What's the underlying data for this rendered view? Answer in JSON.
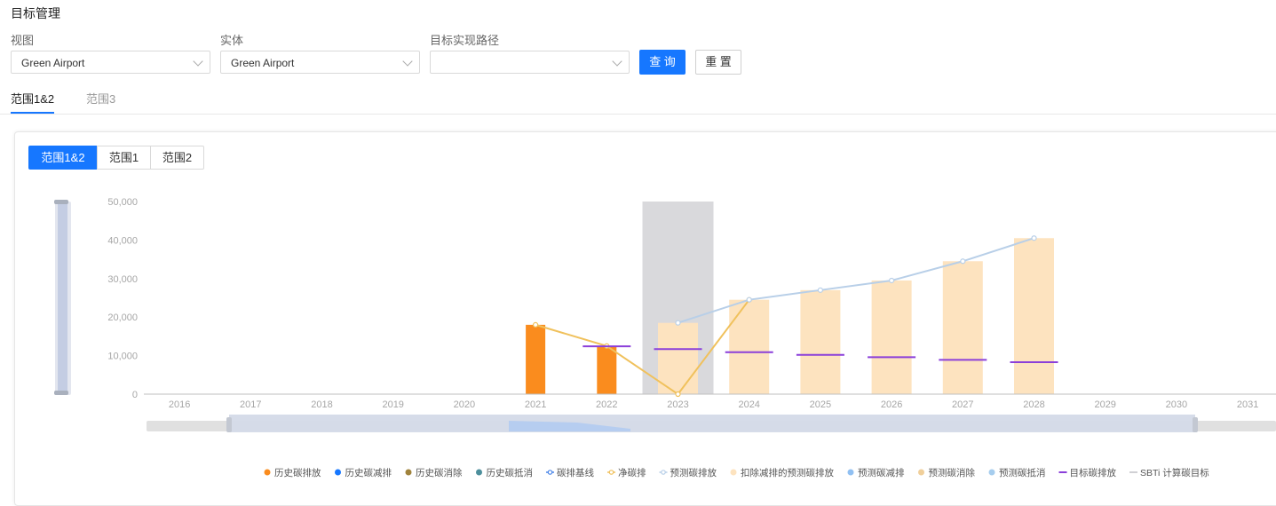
{
  "page": {
    "title": "目标管理"
  },
  "filters": {
    "view_label": "视图",
    "view_value": "Green Airport",
    "entity_label": "实体",
    "entity_value": "Green Airport",
    "path_label": "目标实现路径",
    "path_value": "",
    "query_button": "查 询",
    "reset_button": "重 置"
  },
  "tabs": [
    "范围1&2",
    "范围3"
  ],
  "segments": [
    "范围1&2",
    "范围1",
    "范围2"
  ],
  "colors": {
    "accent": "#1677ff",
    "hist_emission": "#fa8c1e",
    "forecast_deducted": "#fde3bf",
    "forecast_emission_line": "#b8cfe8",
    "net_emission_line": "#f0c15c",
    "target": "#8b3fd9",
    "sbti": "#d9d9dc"
  },
  "chart_data": {
    "type": "bar",
    "categories": [
      "2016",
      "2017",
      "2018",
      "2019",
      "2020",
      "2021",
      "2022",
      "2023",
      "2024",
      "2025",
      "2026",
      "2027",
      "2028",
      "2029",
      "2030",
      "2031"
    ],
    "y_ticks": [
      "0",
      "10,000",
      "20,000",
      "30,000",
      "40,000",
      "50,000"
    ],
    "ylim": [
      0,
      50000
    ],
    "grid": false,
    "series": [
      {
        "name": "历史碳排放",
        "kind": "bar",
        "color": "#fa8c1e",
        "values": [
          null,
          null,
          null,
          null,
          null,
          18000,
          12500,
          null,
          null,
          null,
          null,
          null,
          null,
          null,
          null,
          null
        ]
      },
      {
        "name": "扣除减排的预测碳排放",
        "kind": "bar",
        "color": "#fde3bf",
        "values": [
          null,
          null,
          null,
          null,
          null,
          null,
          null,
          18500,
          24500,
          27000,
          29500,
          34500,
          40500,
          null,
          null,
          null
        ]
      },
      {
        "name": "SBTi 计算碳目标",
        "kind": "bar",
        "color": "#d9d9dc",
        "values": [
          null,
          null,
          null,
          null,
          null,
          null,
          null,
          50000,
          null,
          null,
          null,
          null,
          null,
          null,
          null,
          null
        ]
      },
      {
        "name": "净碳排",
        "kind": "line",
        "color": "#f0c15c",
        "values": [
          null,
          null,
          null,
          null,
          null,
          18000,
          12500,
          0,
          24500,
          null,
          null,
          null,
          null,
          null,
          null,
          null
        ]
      },
      {
        "name": "预测碳排放",
        "kind": "line",
        "color": "#b8cfe8",
        "values": [
          null,
          null,
          null,
          null,
          null,
          null,
          null,
          18500,
          24500,
          27000,
          29500,
          34500,
          40500,
          null,
          null,
          null
        ]
      },
      {
        "name": "目标碳排放",
        "kind": "marker",
        "color": "#8b3fd9",
        "values": [
          null,
          null,
          null,
          null,
          null,
          null,
          12400,
          11700,
          10900,
          10200,
          9600,
          8900,
          8300,
          null,
          null,
          null
        ]
      }
    ],
    "legend": [
      {
        "label": "历史碳排放",
        "color": "#fa8c1e",
        "shape": "dot"
      },
      {
        "label": "历史碳减排",
        "color": "#1677ff",
        "shape": "dot"
      },
      {
        "label": "历史碳消除",
        "color": "#a0833c",
        "shape": "dot"
      },
      {
        "label": "历史碳抵消",
        "color": "#4d8f9c",
        "shape": "dot"
      },
      {
        "label": "碳排基线",
        "color": "#4a86e8",
        "shape": "line-circle"
      },
      {
        "label": "净碳排",
        "color": "#f0c15c",
        "shape": "line-circle"
      },
      {
        "label": "预测碳排放",
        "color": "#b8cfe8",
        "shape": "line-circle"
      },
      {
        "label": "扣除减排的预测碳排放",
        "color": "#fde3bf",
        "shape": "dot"
      },
      {
        "label": "预测碳减排",
        "color": "#91c0f2",
        "shape": "dot"
      },
      {
        "label": "预测碳消除",
        "color": "#f0cf9a",
        "shape": "dot"
      },
      {
        "label": "预测碳抵消",
        "color": "#a6cdee",
        "shape": "dot"
      },
      {
        "label": "目标碳排放",
        "color": "#8b3fd9",
        "shape": "line"
      },
      {
        "label": "SBTi 计算碳目标",
        "color": "#d0d0d4",
        "shape": "line"
      }
    ],
    "legend_position": "bottom"
  }
}
